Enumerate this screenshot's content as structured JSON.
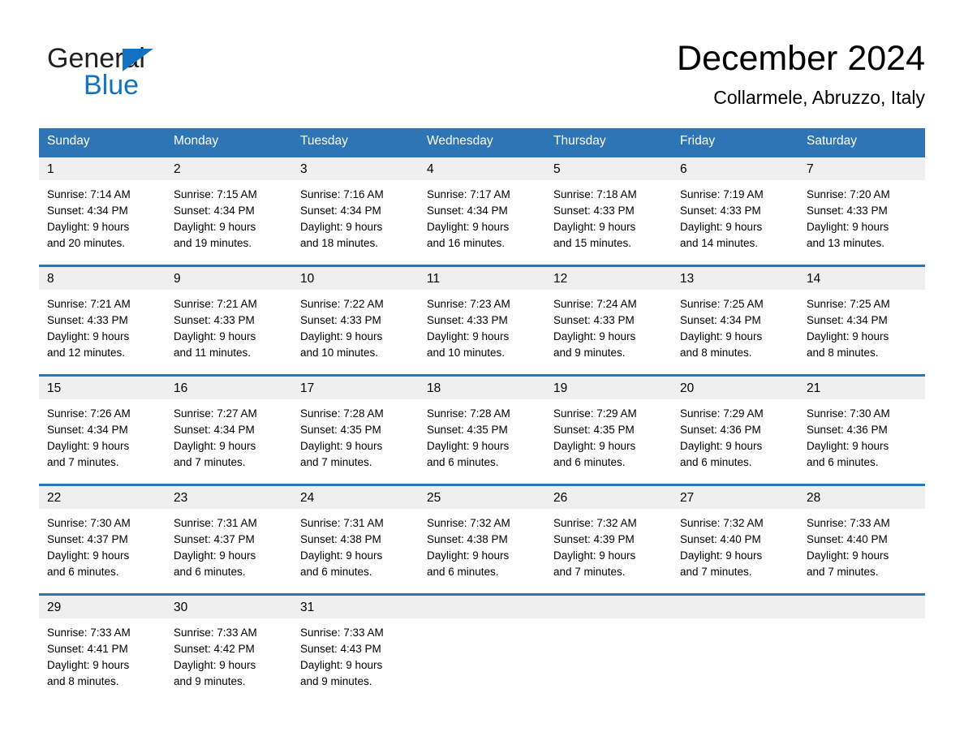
{
  "brand": {
    "name_part1": "General",
    "name_part2": "Blue",
    "accent_color": "#1273c4"
  },
  "header": {
    "month_title": "December 2024",
    "location": "Collarmele, Abruzzo, Italy",
    "header_bg_color": "#2e75b6",
    "daynum_bg_color": "#efefef"
  },
  "weekday_headers": [
    "Sunday",
    "Monday",
    "Tuesday",
    "Wednesday",
    "Thursday",
    "Friday",
    "Saturday"
  ],
  "weeks": [
    [
      {
        "day": "1",
        "sunrise": "Sunrise: 7:14 AM",
        "sunset": "Sunset: 4:34 PM",
        "daylight_line1": "Daylight: 9 hours",
        "daylight_line2": "and 20 minutes."
      },
      {
        "day": "2",
        "sunrise": "Sunrise: 7:15 AM",
        "sunset": "Sunset: 4:34 PM",
        "daylight_line1": "Daylight: 9 hours",
        "daylight_line2": "and 19 minutes."
      },
      {
        "day": "3",
        "sunrise": "Sunrise: 7:16 AM",
        "sunset": "Sunset: 4:34 PM",
        "daylight_line1": "Daylight: 9 hours",
        "daylight_line2": "and 18 minutes."
      },
      {
        "day": "4",
        "sunrise": "Sunrise: 7:17 AM",
        "sunset": "Sunset: 4:34 PM",
        "daylight_line1": "Daylight: 9 hours",
        "daylight_line2": "and 16 minutes."
      },
      {
        "day": "5",
        "sunrise": "Sunrise: 7:18 AM",
        "sunset": "Sunset: 4:33 PM",
        "daylight_line1": "Daylight: 9 hours",
        "daylight_line2": "and 15 minutes."
      },
      {
        "day": "6",
        "sunrise": "Sunrise: 7:19 AM",
        "sunset": "Sunset: 4:33 PM",
        "daylight_line1": "Daylight: 9 hours",
        "daylight_line2": "and 14 minutes."
      },
      {
        "day": "7",
        "sunrise": "Sunrise: 7:20 AM",
        "sunset": "Sunset: 4:33 PM",
        "daylight_line1": "Daylight: 9 hours",
        "daylight_line2": "and 13 minutes."
      }
    ],
    [
      {
        "day": "8",
        "sunrise": "Sunrise: 7:21 AM",
        "sunset": "Sunset: 4:33 PM",
        "daylight_line1": "Daylight: 9 hours",
        "daylight_line2": "and 12 minutes."
      },
      {
        "day": "9",
        "sunrise": "Sunrise: 7:21 AM",
        "sunset": "Sunset: 4:33 PM",
        "daylight_line1": "Daylight: 9 hours",
        "daylight_line2": "and 11 minutes."
      },
      {
        "day": "10",
        "sunrise": "Sunrise: 7:22 AM",
        "sunset": "Sunset: 4:33 PM",
        "daylight_line1": "Daylight: 9 hours",
        "daylight_line2": "and 10 minutes."
      },
      {
        "day": "11",
        "sunrise": "Sunrise: 7:23 AM",
        "sunset": "Sunset: 4:33 PM",
        "daylight_line1": "Daylight: 9 hours",
        "daylight_line2": "and 10 minutes."
      },
      {
        "day": "12",
        "sunrise": "Sunrise: 7:24 AM",
        "sunset": "Sunset: 4:33 PM",
        "daylight_line1": "Daylight: 9 hours",
        "daylight_line2": "and 9 minutes."
      },
      {
        "day": "13",
        "sunrise": "Sunrise: 7:25 AM",
        "sunset": "Sunset: 4:34 PM",
        "daylight_line1": "Daylight: 9 hours",
        "daylight_line2": "and 8 minutes."
      },
      {
        "day": "14",
        "sunrise": "Sunrise: 7:25 AM",
        "sunset": "Sunset: 4:34 PM",
        "daylight_line1": "Daylight: 9 hours",
        "daylight_line2": "and 8 minutes."
      }
    ],
    [
      {
        "day": "15",
        "sunrise": "Sunrise: 7:26 AM",
        "sunset": "Sunset: 4:34 PM",
        "daylight_line1": "Daylight: 9 hours",
        "daylight_line2": "and 7 minutes."
      },
      {
        "day": "16",
        "sunrise": "Sunrise: 7:27 AM",
        "sunset": "Sunset: 4:34 PM",
        "daylight_line1": "Daylight: 9 hours",
        "daylight_line2": "and 7 minutes."
      },
      {
        "day": "17",
        "sunrise": "Sunrise: 7:28 AM",
        "sunset": "Sunset: 4:35 PM",
        "daylight_line1": "Daylight: 9 hours",
        "daylight_line2": "and 7 minutes."
      },
      {
        "day": "18",
        "sunrise": "Sunrise: 7:28 AM",
        "sunset": "Sunset: 4:35 PM",
        "daylight_line1": "Daylight: 9 hours",
        "daylight_line2": "and 6 minutes."
      },
      {
        "day": "19",
        "sunrise": "Sunrise: 7:29 AM",
        "sunset": "Sunset: 4:35 PM",
        "daylight_line1": "Daylight: 9 hours",
        "daylight_line2": "and 6 minutes."
      },
      {
        "day": "20",
        "sunrise": "Sunrise: 7:29 AM",
        "sunset": "Sunset: 4:36 PM",
        "daylight_line1": "Daylight: 9 hours",
        "daylight_line2": "and 6 minutes."
      },
      {
        "day": "21",
        "sunrise": "Sunrise: 7:30 AM",
        "sunset": "Sunset: 4:36 PM",
        "daylight_line1": "Daylight: 9 hours",
        "daylight_line2": "and 6 minutes."
      }
    ],
    [
      {
        "day": "22",
        "sunrise": "Sunrise: 7:30 AM",
        "sunset": "Sunset: 4:37 PM",
        "daylight_line1": "Daylight: 9 hours",
        "daylight_line2": "and 6 minutes."
      },
      {
        "day": "23",
        "sunrise": "Sunrise: 7:31 AM",
        "sunset": "Sunset: 4:37 PM",
        "daylight_line1": "Daylight: 9 hours",
        "daylight_line2": "and 6 minutes."
      },
      {
        "day": "24",
        "sunrise": "Sunrise: 7:31 AM",
        "sunset": "Sunset: 4:38 PM",
        "daylight_line1": "Daylight: 9 hours",
        "daylight_line2": "and 6 minutes."
      },
      {
        "day": "25",
        "sunrise": "Sunrise: 7:32 AM",
        "sunset": "Sunset: 4:38 PM",
        "daylight_line1": "Daylight: 9 hours",
        "daylight_line2": "and 6 minutes."
      },
      {
        "day": "26",
        "sunrise": "Sunrise: 7:32 AM",
        "sunset": "Sunset: 4:39 PM",
        "daylight_line1": "Daylight: 9 hours",
        "daylight_line2": "and 7 minutes."
      },
      {
        "day": "27",
        "sunrise": "Sunrise: 7:32 AM",
        "sunset": "Sunset: 4:40 PM",
        "daylight_line1": "Daylight: 9 hours",
        "daylight_line2": "and 7 minutes."
      },
      {
        "day": "28",
        "sunrise": "Sunrise: 7:33 AM",
        "sunset": "Sunset: 4:40 PM",
        "daylight_line1": "Daylight: 9 hours",
        "daylight_line2": "and 7 minutes."
      }
    ],
    [
      {
        "day": "29",
        "sunrise": "Sunrise: 7:33 AM",
        "sunset": "Sunset: 4:41 PM",
        "daylight_line1": "Daylight: 9 hours",
        "daylight_line2": "and 8 minutes."
      },
      {
        "day": "30",
        "sunrise": "Sunrise: 7:33 AM",
        "sunset": "Sunset: 4:42 PM",
        "daylight_line1": "Daylight: 9 hours",
        "daylight_line2": "and 9 minutes."
      },
      {
        "day": "31",
        "sunrise": "Sunrise: 7:33 AM",
        "sunset": "Sunset: 4:43 PM",
        "daylight_line1": "Daylight: 9 hours",
        "daylight_line2": "and 9 minutes."
      },
      {
        "day": "",
        "sunrise": "",
        "sunset": "",
        "daylight_line1": "",
        "daylight_line2": ""
      },
      {
        "day": "",
        "sunrise": "",
        "sunset": "",
        "daylight_line1": "",
        "daylight_line2": ""
      },
      {
        "day": "",
        "sunrise": "",
        "sunset": "",
        "daylight_line1": "",
        "daylight_line2": ""
      },
      {
        "day": "",
        "sunrise": "",
        "sunset": "",
        "daylight_line1": "",
        "daylight_line2": ""
      }
    ]
  ]
}
